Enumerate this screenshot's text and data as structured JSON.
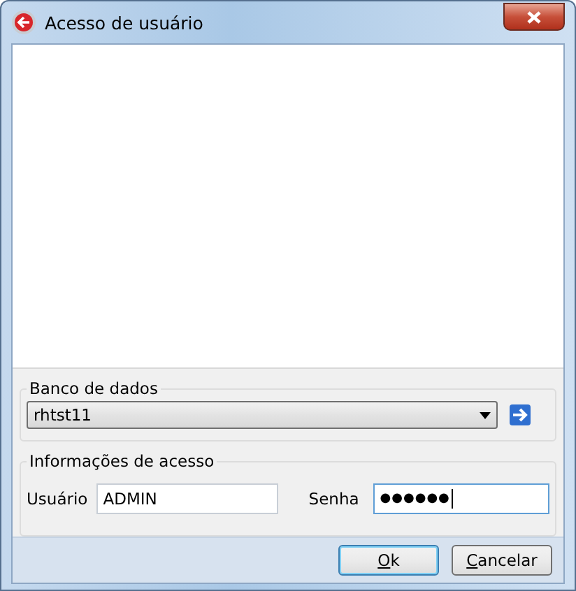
{
  "window": {
    "title": "Acesso de usuário"
  },
  "database": {
    "legend": "Banco de dados",
    "value": "rhtst11"
  },
  "access": {
    "legend": "Informações de acesso",
    "user_label": "Usuário",
    "user_value": "ADMIN",
    "password_label": "Senha",
    "password_value": "●●●●●●",
    "password_focused": true
  },
  "buttons": [
    {
      "label": "Ok",
      "default": true
    },
    {
      "label": "Cancelar",
      "default": false
    }
  ]
}
